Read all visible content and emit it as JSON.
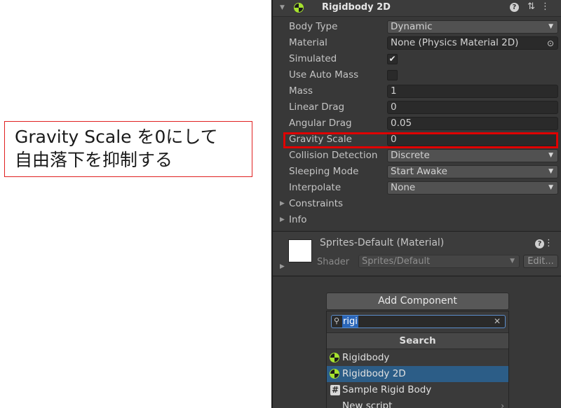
{
  "annotation": {
    "line1": "Gravity Scale を0にして",
    "line2": "自由落下を抑制する"
  },
  "component": {
    "title": "Rigidbody 2D",
    "header_icons": {
      "help": "question-icon",
      "settings": "sliders-icon",
      "menu": "kebab-icon"
    },
    "fields": {
      "body_type": {
        "label": "Body Type",
        "value": "Dynamic"
      },
      "material": {
        "label": "Material",
        "value": "None (Physics Material 2D)"
      },
      "simulated": {
        "label": "Simulated",
        "checked": true,
        "mark": "✔"
      },
      "use_auto_mass": {
        "label": "Use Auto Mass",
        "checked": false
      },
      "mass": {
        "label": "Mass",
        "value": "1"
      },
      "linear_drag": {
        "label": "Linear Drag",
        "value": "0"
      },
      "angular_drag": {
        "label": "Angular Drag",
        "value": "0.05"
      },
      "gravity_scale": {
        "label": "Gravity Scale",
        "value": "0"
      },
      "collision_detection": {
        "label": "Collision Detection",
        "value": "Discrete"
      },
      "sleeping_mode": {
        "label": "Sleeping Mode",
        "value": "Start Awake"
      },
      "interpolate": {
        "label": "Interpolate",
        "value": "None"
      }
    },
    "foldouts": {
      "constraints": "Constraints",
      "info": "Info"
    }
  },
  "material_section": {
    "title": "Sprites-Default (Material)",
    "shader_label": "Shader",
    "shader_value": "Sprites/Default",
    "edit_button": "Edit..."
  },
  "add_component": {
    "button_label": "Add Component",
    "search_value": "rigi",
    "list_header": "Search",
    "results": [
      {
        "label": "Rigidbody",
        "icon": "rigidbody-icon",
        "selected": false
      },
      {
        "label": "Rigidbody 2D",
        "icon": "rigidbody-icon",
        "selected": true
      },
      {
        "label": "Sample Rigid Body",
        "icon": "script-hash-icon",
        "selected": false
      },
      {
        "label": "New script",
        "icon": "",
        "selected": false
      }
    ]
  },
  "colors": {
    "panel_bg": "#383838",
    "highlight_red": "#e00000",
    "selection_blue": "#2c5d87",
    "rigidbody_green": "#a6e22e"
  }
}
